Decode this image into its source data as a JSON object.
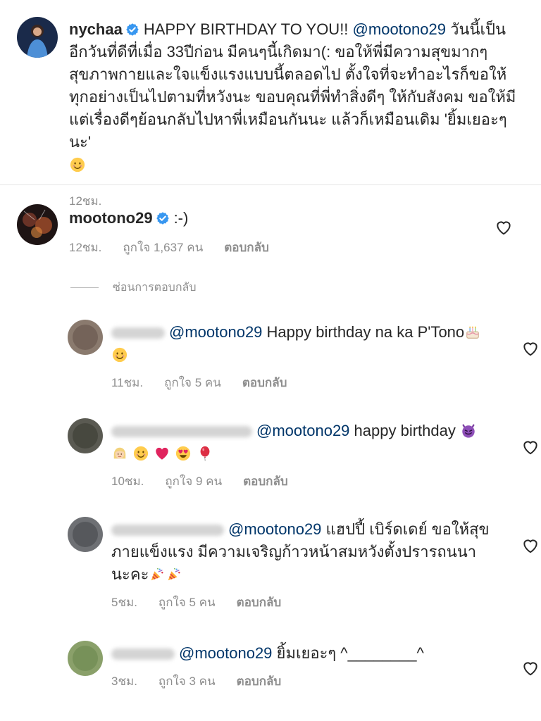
{
  "caption": {
    "username": "nychaa",
    "text_mention": "@mootono29",
    "text_pre": "HAPPY BIRTHDAY TO YOU!!",
    "text_post": "วันนี้เป็นอีกวันที่ดีที่เมื่อ 33ปีก่อน มีคนๆนี้เกิดมา(: ขอให้พี่มีความสุขมากๆ สุขภาพกายและใจแข็งแรงแบบนี้ตลอดไป ตั้งใจที่จะทำอะไรก็ขอให้ทุกอย่างเป็นไปตามที่หวังนะ ขอบคุณที่พี่ทำสิ่งดีๆ ให้กับสังคม ขอให้มีแต่เรื่องดีๆย้อนกลับไปหาพี่เหมือนกันนะ แล้วก็เหมือนเดิม 'ยิ้มเยอะๆนะ'",
    "time": "12ชม."
  },
  "main_comment": {
    "username": "mootono29",
    "text": ":-)",
    "time": "12ชม.",
    "likes": "ถูกใจ 1,637 คน",
    "reply": "ตอบกลับ"
  },
  "hide_replies": "ซ่อนการตอบกลับ",
  "replies": [
    {
      "mention": "@mootono29",
      "text": "Happy birthday na ka P'Tono",
      "time": "11ชม.",
      "likes": "ถูกใจ 5 คน",
      "reply": "ตอบกลับ"
    },
    {
      "mention": "@mootono29",
      "text": "happy birthday",
      "time": "10ชม.",
      "likes": "ถูกใจ 9 คน",
      "reply": "ตอบกลับ"
    },
    {
      "mention": "@mootono29",
      "text": "แฮปปี้ เบิร์ดเดย์ ขอให้สุขภายแข็งแรง มีความเจริญก้าวหน้าสมหวังตั้งปรารถนนานะคะ",
      "time": "5ชม.",
      "likes": "ถูกใจ 5 คน",
      "reply": "ตอบกลับ"
    },
    {
      "mention": "@mootono29",
      "text": "ยิ้มเยอะๆ ^________^",
      "time": "3ชม.",
      "likes": "ถูกใจ 3 คน",
      "reply": "ตอบกลับ"
    }
  ],
  "colors": {
    "verified": "#3897f0",
    "mention": "#003569",
    "meta": "#8e8e8e",
    "text": "#262626"
  }
}
